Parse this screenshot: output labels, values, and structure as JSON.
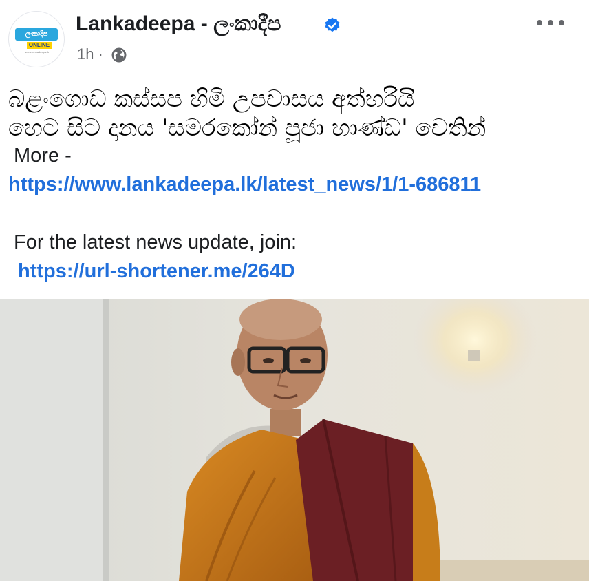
{
  "post": {
    "page_name": "Lankadeepa - ලංකාදීප",
    "time": "1h",
    "separator": "·",
    "headline_line1": "බළංගොඩ කස්සප හිමි උපවාසය අත්හරියි",
    "headline_line2": "හෙට සිට දානය 'සමරකෝන් පූජා භාණ්ඩ' වෙතින්",
    "more_label": "More -",
    "article_link": "https://www.lankadeepa.lk/latest_news/1/1-686811",
    "join_text": "For the latest news update, join:",
    "join_link": "https://url-shortener.me/264D"
  },
  "avatar": {
    "logo_text": "ලංකාදීප",
    "logo_sub": "ONLINE",
    "logo_url": "www.lankadeepa.lk"
  },
  "icons": {
    "verified": "verified-badge-icon",
    "audience": "globe-icon",
    "more": "more-options-icon"
  },
  "colors": {
    "link": "#216fdb",
    "verified": "#1877f2",
    "meta": "#65676b",
    "robe": "#c9781a",
    "robe_dark": "#6b1f24"
  }
}
